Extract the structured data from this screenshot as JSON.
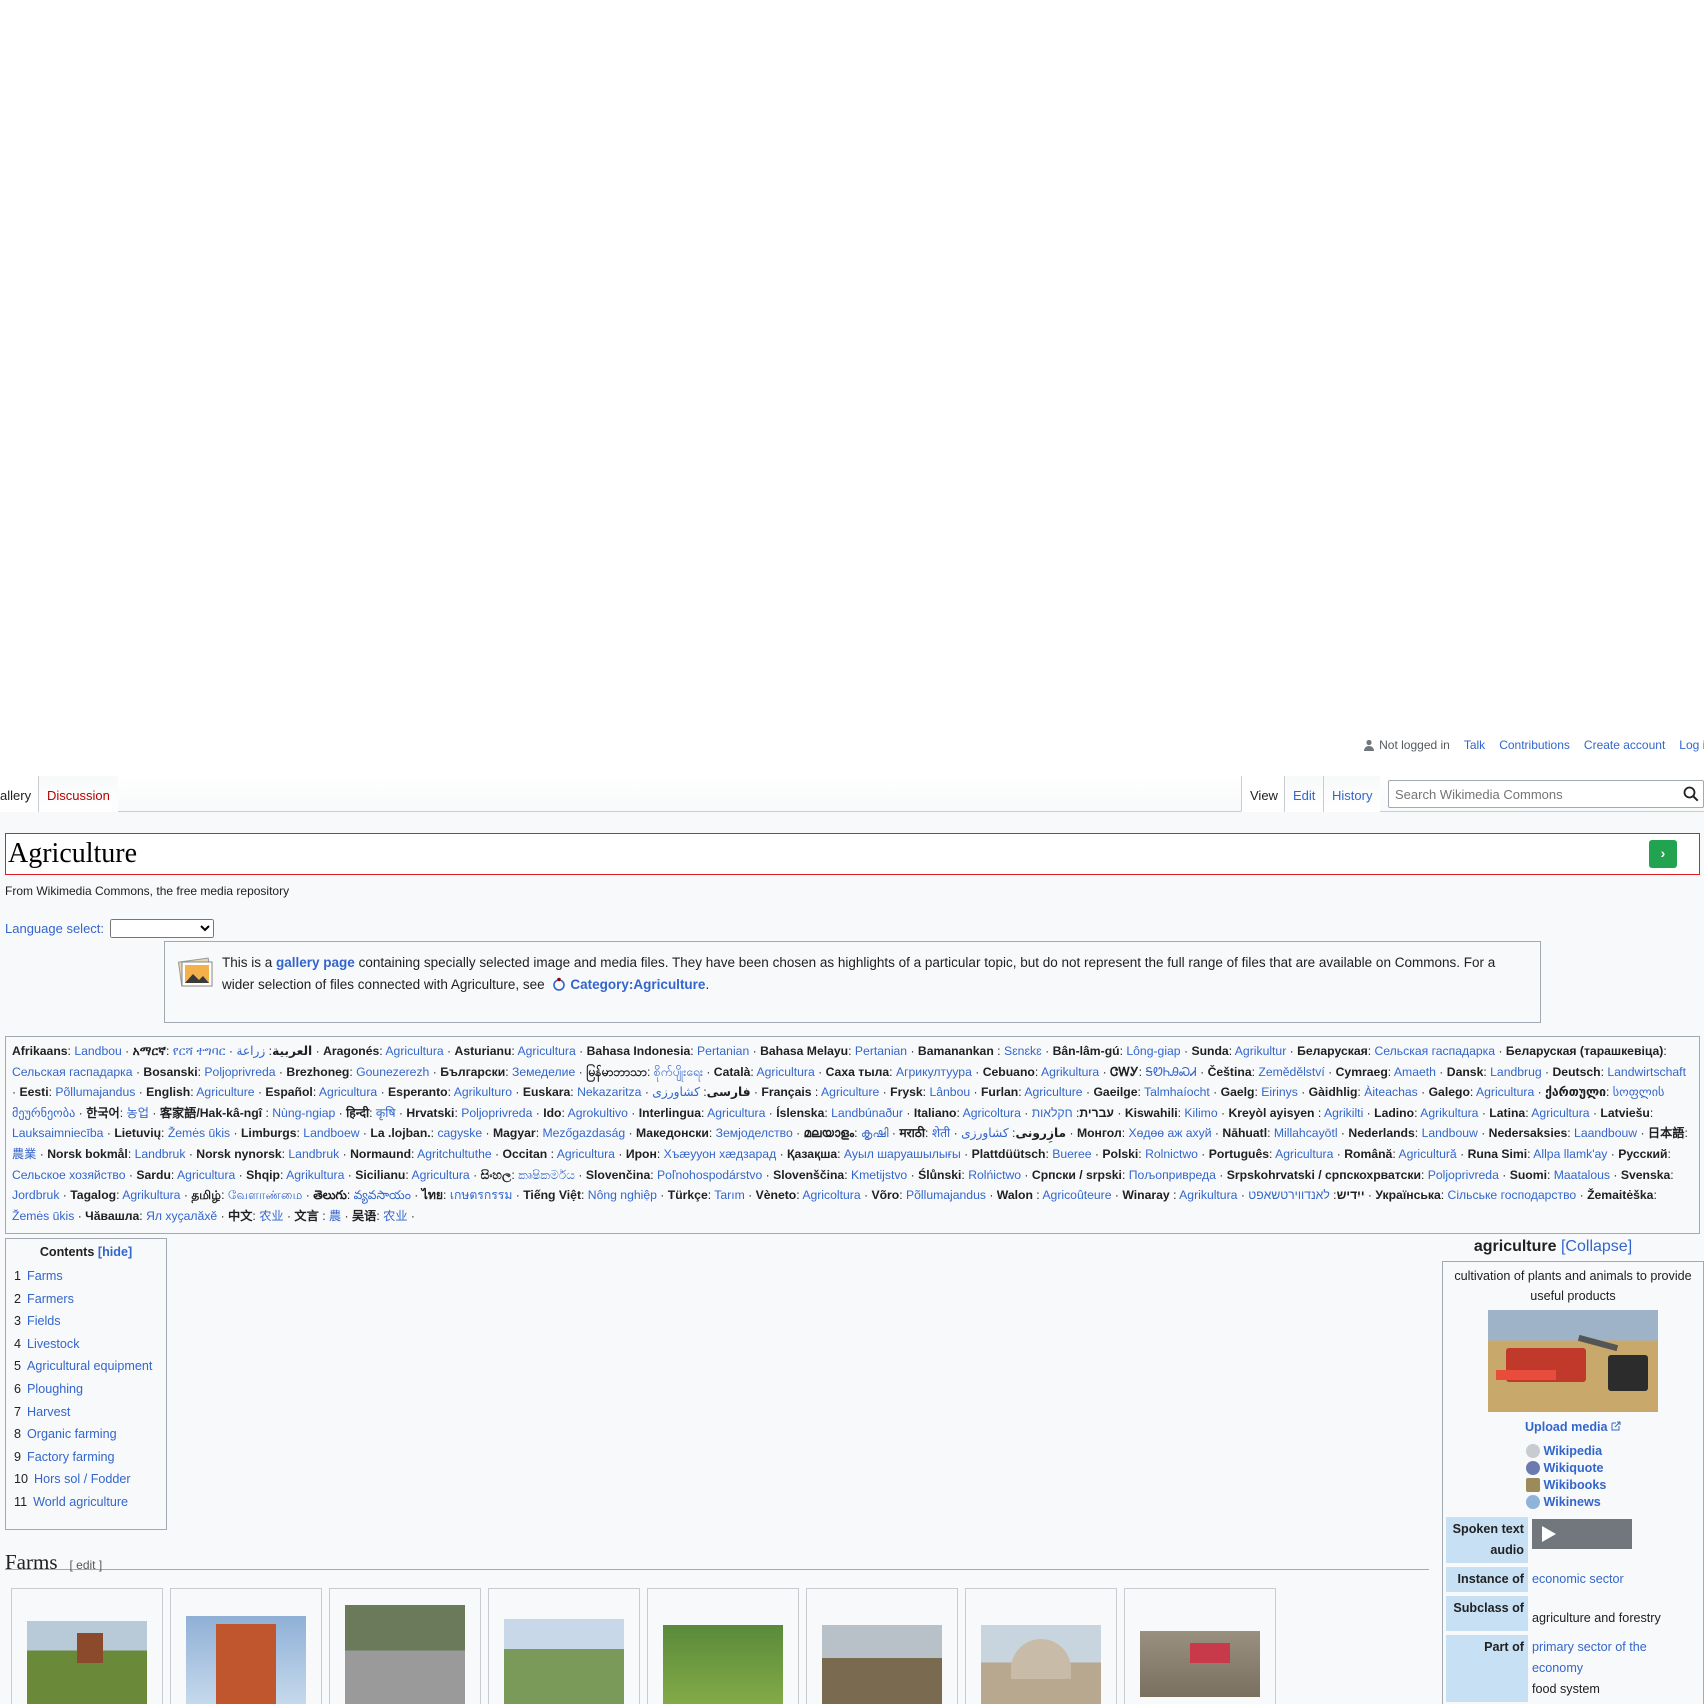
{
  "personal": {
    "status": "Not logged in",
    "links": [
      "Talk",
      "Contributions",
      "Create account",
      "Log in"
    ]
  },
  "tabs": {
    "left": [
      "allery",
      "Discussion"
    ],
    "right": [
      "View",
      "Edit",
      "History"
    ]
  },
  "search": {
    "placeholder": "Search Wikimedia Commons"
  },
  "page": {
    "title": "Agriculture",
    "subtitle": "From Wikimedia Commons, the free media repository",
    "lang_select_label": "Language select:"
  },
  "notice": {
    "pre": "This is a ",
    "link1": "gallery page",
    "mid": " containing specially selected image and media files. They have been chosen as highlights of a particular topic, but do not represent the full range of files that are available on Commons. For a wider selection of files connected with Agriculture, see ",
    "link2": "Category:Agriculture",
    "post": "."
  },
  "languages": [
    [
      "Afrikaans",
      "Landbou"
    ],
    [
      "አማርኛ",
      "የርሻ ተግባር"
    ],
    [
      "العربية",
      "زراعة"
    ],
    [
      "Aragonés",
      "Agricultura"
    ],
    [
      "Asturianu",
      "Agricultura"
    ],
    [
      "Bahasa Indonesia",
      "Pertanian"
    ],
    [
      "Bahasa Melayu",
      "Pertanian"
    ],
    [
      "Bamanankan ",
      "Sɛnɛkɛ"
    ],
    [
      "Bân-lâm-gú",
      "Lông-giap"
    ],
    [
      "Sunda",
      "Agrikultur"
    ],
    [
      "Беларуская",
      "Сельская гаспадарка"
    ],
    [
      "Беларуская (тарашкевіца)",
      "Сельская гаспадарка"
    ],
    [
      "Bosanski",
      "Poljoprivreda"
    ],
    [
      "Brezhoneg",
      "Gounezerezh"
    ],
    [
      "Български",
      "Земеделие"
    ],
    [
      "မြန်မာဘာသာ",
      "စိုက်ပျိုးရေး"
    ],
    [
      "Català",
      "Agricultura"
    ],
    [
      "Саха тыла",
      "Агрикултуура"
    ],
    [
      "Cebuano",
      "Agrikultura"
    ],
    [
      "ᏣᎳᎩ",
      "ᎦᏬᏂᎯᏍᏗ"
    ],
    [
      "Čeština",
      "Zemědělství"
    ],
    [
      "Cymraeg",
      "Amaeth"
    ],
    [
      "Dansk",
      "Landbrug"
    ],
    [
      "Deutsch",
      "Landwirtschaft"
    ],
    [
      "Eesti",
      "Põllumajandus"
    ],
    [
      "English",
      "Agriculture"
    ],
    [
      "Español",
      "Agricultura"
    ],
    [
      "Esperanto",
      "Agrikulturo"
    ],
    [
      "Euskara",
      "Nekazaritza"
    ],
    [
      "فارسی",
      "کشاورزی"
    ],
    [
      "Français ",
      "Agriculture"
    ],
    [
      "Frysk",
      "Lânbou"
    ],
    [
      "Furlan",
      "Agriculture"
    ],
    [
      "Gaeilge",
      "Talmhaíocht"
    ],
    [
      "Gaelg",
      "Eirinys"
    ],
    [
      "Gàidhlig",
      "Àiteachas"
    ],
    [
      "Galego",
      "Agricultura"
    ],
    [
      "ქართული",
      "სოფლის მეურნეობა"
    ],
    [
      "한국어",
      "농업"
    ],
    [
      "客家語/Hak-kâ-ngî ",
      "Nùng-ngiap"
    ],
    [
      "हिन्दी",
      "कृषि"
    ],
    [
      "Hrvatski",
      "Poljoprivreda"
    ],
    [
      "Ido",
      "Agrokultivo"
    ],
    [
      "Interlingua",
      "Agricultura"
    ],
    [
      "Íslenska",
      "Landbúnaður"
    ],
    [
      "Italiano",
      "Agricoltura"
    ],
    [
      "עברית",
      "חקלאות"
    ],
    [
      "Kiswahili",
      "Kilimo"
    ],
    [
      "Kreyòl ayisyen ",
      "Agrikilti"
    ],
    [
      "Ladino",
      "Agrikultura"
    ],
    [
      "Latina",
      "Agricultura"
    ],
    [
      "Latviešu",
      "Lauksaimniecība"
    ],
    [
      "Lietuvių",
      "Žemės ūkis"
    ],
    [
      "Limburgs",
      "Landboew"
    ],
    [
      "La .lojban.",
      "cagyske"
    ],
    [
      "Magyar",
      "Mezőgazdaság"
    ],
    [
      "Македонски",
      "Земјоделство"
    ],
    [
      "മലയാളം",
      "കൃഷി"
    ],
    [
      "मराठी",
      "शेती"
    ],
    [
      "مازِرونی",
      "کشاورزی"
    ],
    [
      "Монгол",
      "Хөдөө аж ахуй"
    ],
    [
      "Nāhuatl",
      "Millahcayōtl"
    ],
    [
      "Nederlands",
      "Landbouw"
    ],
    [
      "Nedersaksies",
      "Laandbouw"
    ],
    [
      "日本語",
      "農業"
    ],
    [
      "Norsk bokmål",
      "Landbruk"
    ],
    [
      "Norsk nynorsk",
      "Landbruk"
    ],
    [
      "Normaund",
      "Agritchultuthe"
    ],
    [
      "Occitan ",
      "Agricultura"
    ],
    [
      "Ирон",
      "Хъæууон хæдзарад"
    ],
    [
      "Қазақша",
      "Ауыл шаруашылығы"
    ],
    [
      "Plattdüütsch",
      "Bueree"
    ],
    [
      "Polski",
      "Rolnictwo"
    ],
    [
      "Português",
      "Agricultura"
    ],
    [
      "Română",
      "Agricultură"
    ],
    [
      "Runa Simi",
      "Allpa llamk'ay"
    ],
    [
      "Русский",
      "Сельское хозяйство"
    ],
    [
      "Sardu",
      "Agricultura"
    ],
    [
      "Shqip",
      "Agrikultura"
    ],
    [
      "Sicilianu",
      "Agricultura"
    ],
    [
      "සිංහල",
      "කෘෂිකර්මය"
    ],
    [
      "Slovenčina",
      "Poľnohospodárstvo"
    ],
    [
      "Slovenščina",
      "Kmetijstvo"
    ],
    [
      "Ślůnski",
      "Rolńictwo"
    ],
    [
      "Српски / srpski",
      "Пољопривреда"
    ],
    [
      "Srpskohrvatski / српскохрватски",
      "Poljoprivreda"
    ],
    [
      "Suomi",
      "Maatalous"
    ],
    [
      "Svenska",
      "Jordbruk"
    ],
    [
      "Tagalog",
      "Agrikultura"
    ],
    [
      "தமிழ்",
      "வேளாண்மை"
    ],
    [
      "తెలుగు",
      "వ్యవసాయం"
    ],
    [
      "ไทย",
      "เกษตรกรรม"
    ],
    [
      "Tiếng Việt",
      "Nông nghiệp"
    ],
    [
      "Türkçe",
      "Tarım"
    ],
    [
      "Vèneto",
      "Agricoltura"
    ],
    [
      "Võro",
      "Põllumajandus"
    ],
    [
      "Walon ",
      "Agricoûteure"
    ],
    [
      "Winaray ",
      "Agrikultura"
    ],
    [
      "ייִדיש",
      "לאנדווירטשאפט"
    ],
    [
      "Українська",
      "Сільське господарство"
    ],
    [
      "Žemaitėška",
      "Žemės ūkis"
    ],
    [
      "Чӑвашла",
      "Ял хуҫалӑхӗ"
    ],
    [
      "中文",
      "农业"
    ],
    [
      "文言 ",
      "農"
    ],
    [
      "吴语",
      "农业"
    ]
  ],
  "toc": {
    "title": "Contents",
    "hide": "[hide]",
    "items": [
      [
        "1",
        "Farms"
      ],
      [
        "2",
        "Farmers"
      ],
      [
        "3",
        "Fields"
      ],
      [
        "4",
        "Livestock"
      ],
      [
        "5",
        "Agricultural equipment"
      ],
      [
        "6",
        "Ploughing"
      ],
      [
        "7",
        "Harvest"
      ],
      [
        "8",
        "Organic farming"
      ],
      [
        "9",
        "Factory farming"
      ],
      [
        "10",
        "Hors sol / Fodder"
      ],
      [
        "11",
        "World agriculture"
      ]
    ]
  },
  "infobox": {
    "title": "agriculture",
    "collapse": "[Collapse]",
    "description": "cultivation of plants and animals to provide useful products",
    "upload": "Upload media",
    "projects": [
      "Wikipedia",
      "Wikiquote",
      "Wikibooks",
      "Wikinews"
    ],
    "rows": [
      {
        "k": "Spoken text audio",
        "v": ""
      },
      {
        "k": "Instance of",
        "v": "economic sector"
      },
      {
        "k": "Subclass of",
        "v": "agriculture and forestry"
      },
      {
        "k": "Part of",
        "v": "primary sector of the economy"
      },
      {
        "k": "",
        "v": "food system"
      }
    ]
  },
  "section": {
    "title": "Farms",
    "edit": "[ edit ]"
  },
  "colors": {
    "link": "#3366cc",
    "border": "#a2a9b1",
    "title_frame": "#e51c23",
    "go_button": "#21a34f"
  }
}
